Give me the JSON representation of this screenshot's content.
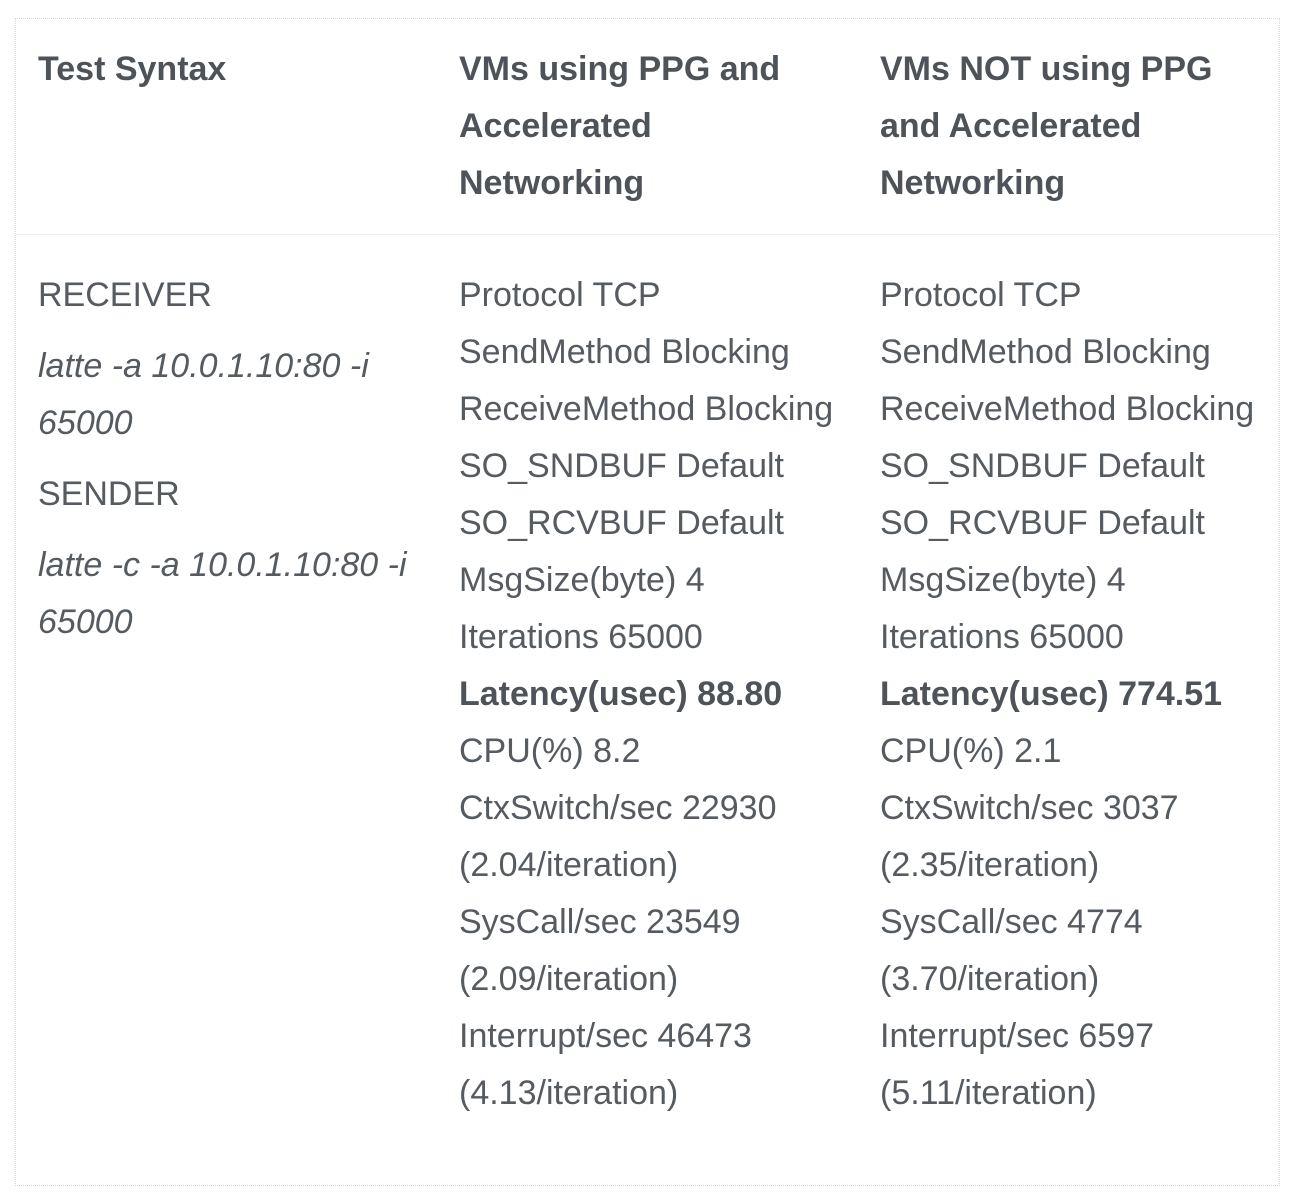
{
  "table": {
    "headers": [
      "Test Syntax",
      "VMs using PPG and Accelerated Networking",
      "VMs NOT using PPG and Accelerated Networking"
    ],
    "syntax": {
      "receiver_label": "RECEIVER",
      "receiver_cmd": "latte -a 10.0.1.10:80 -i 65000",
      "sender_label": "SENDER",
      "sender_cmd": "latte -c -a 10.0.1.10:80 -i 65000"
    },
    "ppg": [
      "Protocol TCP",
      "SendMethod Blocking",
      "ReceiveMethod Blocking",
      "SO_SNDBUF Default",
      "SO_RCVBUF Default",
      "MsgSize(byte) 4",
      "Iterations 65000",
      "Latency(usec) 88.80",
      "CPU(%) 8.2",
      "CtxSwitch/sec 22930 (2.04/iteration)",
      "SysCall/sec 23549 (2.09/iteration)",
      "Interrupt/sec 46473 (4.13/iteration)"
    ],
    "no_ppg": [
      "Protocol TCP",
      "SendMethod Blocking",
      "ReceiveMethod Blocking",
      "SO_SNDBUF Default",
      "SO_RCVBUF Default",
      "MsgSize(byte) 4",
      "Iterations 65000",
      "Latency(usec) 774.51",
      "CPU(%) 2.1",
      "CtxSwitch/sec 3037 (2.35/iteration)",
      "SysCall/sec 4774 (3.70/iteration)",
      "Interrupt/sec 6597 (5.11/iteration)"
    ]
  }
}
